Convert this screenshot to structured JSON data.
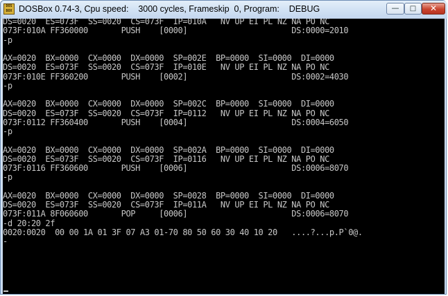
{
  "window": {
    "title": "DOSBox 0.74-3, Cpu speed:    3000 cycles, Frameskip  0, Program:    DEBUG",
    "icon": "dosbox-icon",
    "controls": {
      "minimize": "—",
      "maximize": "□",
      "close": "✕"
    }
  },
  "terminal": {
    "lines": [
      "DS=0020  ES=073F  SS=0020  CS=073F  IP=010A   NV UP EI PL NZ NA PO NC",
      "073F:010A FF360000       PUSH    [0000]                      DS:0000=2010",
      "-p",
      "",
      "AX=0020  BX=0000  CX=0000  DX=0000  SP=002E  BP=0000  SI=0000  DI=0000",
      "DS=0020  ES=073F  SS=0020  CS=073F  IP=010E   NV UP EI PL NZ NA PO NC",
      "073F:010E FF360200       PUSH    [0002]                      DS:0002=4030",
      "-p",
      "",
      "AX=0020  BX=0000  CX=0000  DX=0000  SP=002C  BP=0000  SI=0000  DI=0000",
      "DS=0020  ES=073F  SS=0020  CS=073F  IP=0112   NV UP EI PL NZ NA PO NC",
      "073F:0112 FF360400       PUSH    [0004]                      DS:0004=6050",
      "-p",
      "",
      "AX=0020  BX=0000  CX=0000  DX=0000  SP=002A  BP=0000  SI=0000  DI=0000",
      "DS=0020  ES=073F  SS=0020  CS=073F  IP=0116   NV UP EI PL NZ NA PO NC",
      "073F:0116 FF360600       PUSH    [0006]                      DS:0006=8070",
      "-p",
      "",
      "AX=0020  BX=0000  CX=0000  DX=0000  SP=0028  BP=0000  SI=0000  DI=0000",
      "DS=0020  ES=073F  SS=0020  CS=073F  IP=011A   NV UP EI PL NZ NA PO NC",
      "073F:011A 8F060600       POP     [0006]                      DS:0006=8070",
      "-d 20:20 2f",
      "0020:0020  00 00 1A 01 3F 07 A3 01-70 80 50 60 30 40 10 20   ....?...p.P`0@.",
      "-"
    ]
  }
}
